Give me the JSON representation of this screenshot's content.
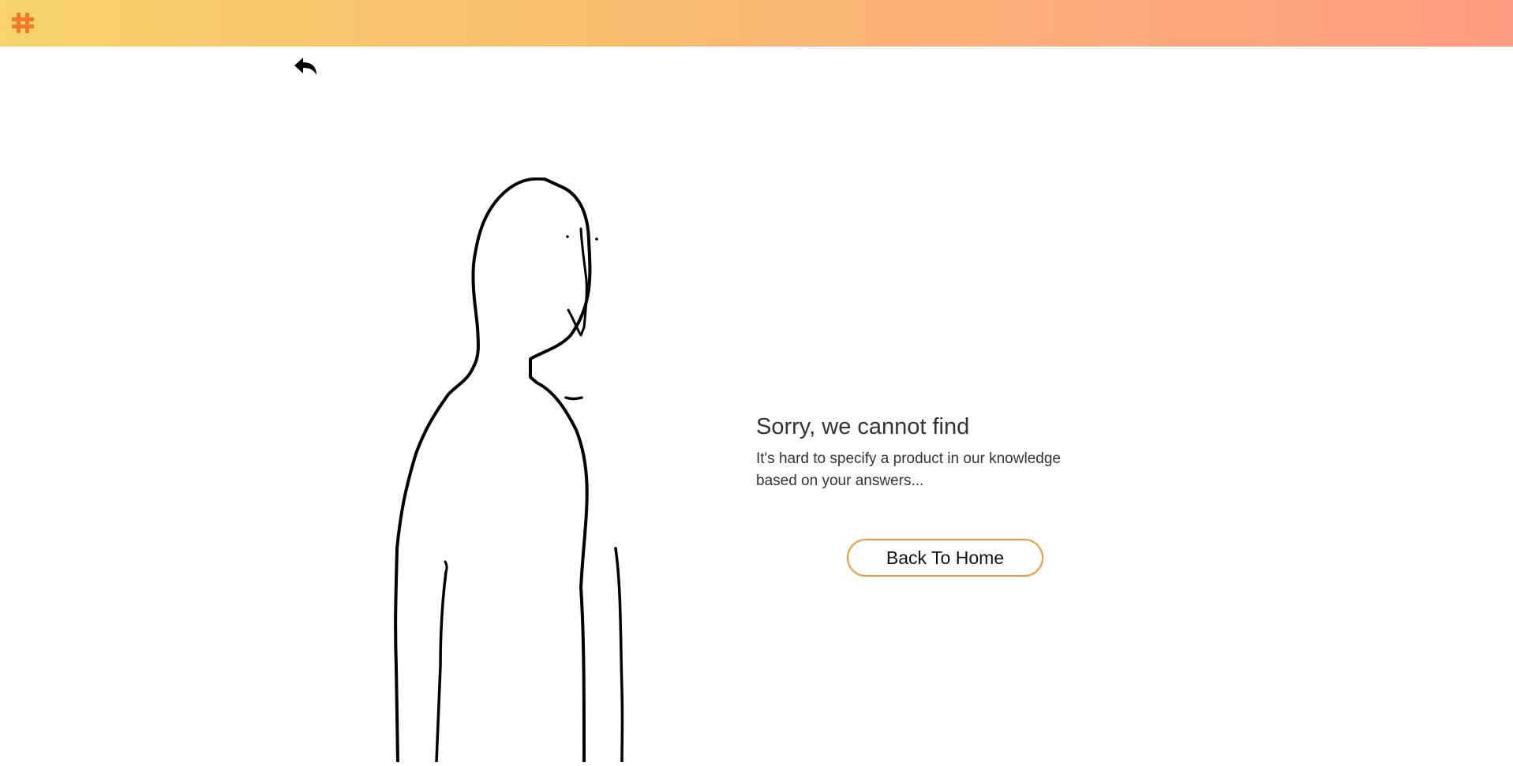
{
  "header": {
    "logo_icon": "brand-logo-icon",
    "gradient_start": "#f7d36a",
    "gradient_end": "#ff9b80",
    "logo_color": "#f47a2a"
  },
  "nav": {
    "back_icon": "reply-arrow-icon"
  },
  "illustration": {
    "icon": "sad-person-drawing"
  },
  "message": {
    "title": "Sorry, we cannot find",
    "description": "It's hard to specify a product in our knowledge based on your answers..."
  },
  "actions": {
    "home_button_label": "Back To Home",
    "accent_color": "#f5963a"
  }
}
